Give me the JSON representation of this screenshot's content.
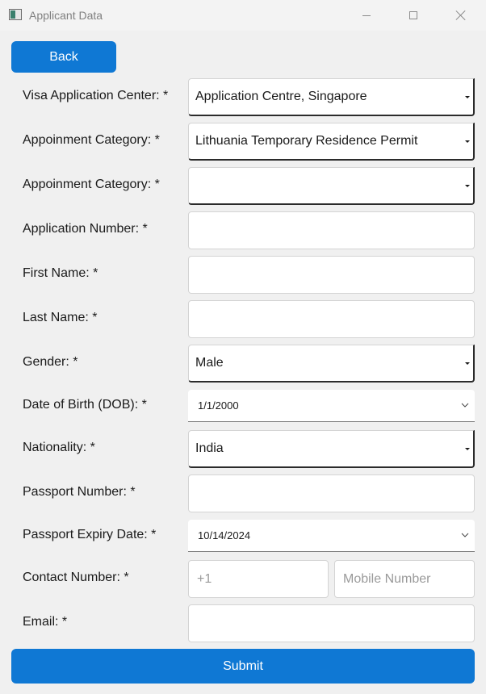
{
  "window": {
    "title": "Applicant Data"
  },
  "buttons": {
    "back": "Back",
    "submit": "Submit"
  },
  "form": {
    "visa_center": {
      "label": "Visa Application Center: *",
      "value": "Application Centre, Singapore"
    },
    "appointment_category_1": {
      "label": "Appoinment Category: *",
      "value": "Lithuania Temporary Residence Permit"
    },
    "appointment_category_2": {
      "label": "Appoinment Category: *",
      "value": ""
    },
    "application_number": {
      "label": "Application Number: *",
      "value": ""
    },
    "first_name": {
      "label": "First Name: *",
      "value": ""
    },
    "last_name": {
      "label": "Last Name: *",
      "value": ""
    },
    "gender": {
      "label": "Gender: *",
      "value": "Male"
    },
    "dob": {
      "label": "Date of Birth (DOB): *",
      "value": "1/1/2000"
    },
    "nationality": {
      "label": "Nationality: *",
      "value": "India"
    },
    "passport_number": {
      "label": "Passport Number: *",
      "value": ""
    },
    "passport_expiry": {
      "label": "Passport Expiry Date: *",
      "value": "10/14/2024"
    },
    "contact_number": {
      "label": "Contact Number: *",
      "country_code_placeholder": "+1",
      "mobile_placeholder": "Mobile Number"
    },
    "email": {
      "label": "Email: *",
      "value": ""
    }
  },
  "icons": {
    "app": "app-window-icon",
    "minimize": "minimize-icon",
    "maximize": "maximize-icon",
    "close": "close-icon",
    "combo_arrow": "dropdown-arrow-icon",
    "date_chevron": "chevron-down-icon"
  }
}
